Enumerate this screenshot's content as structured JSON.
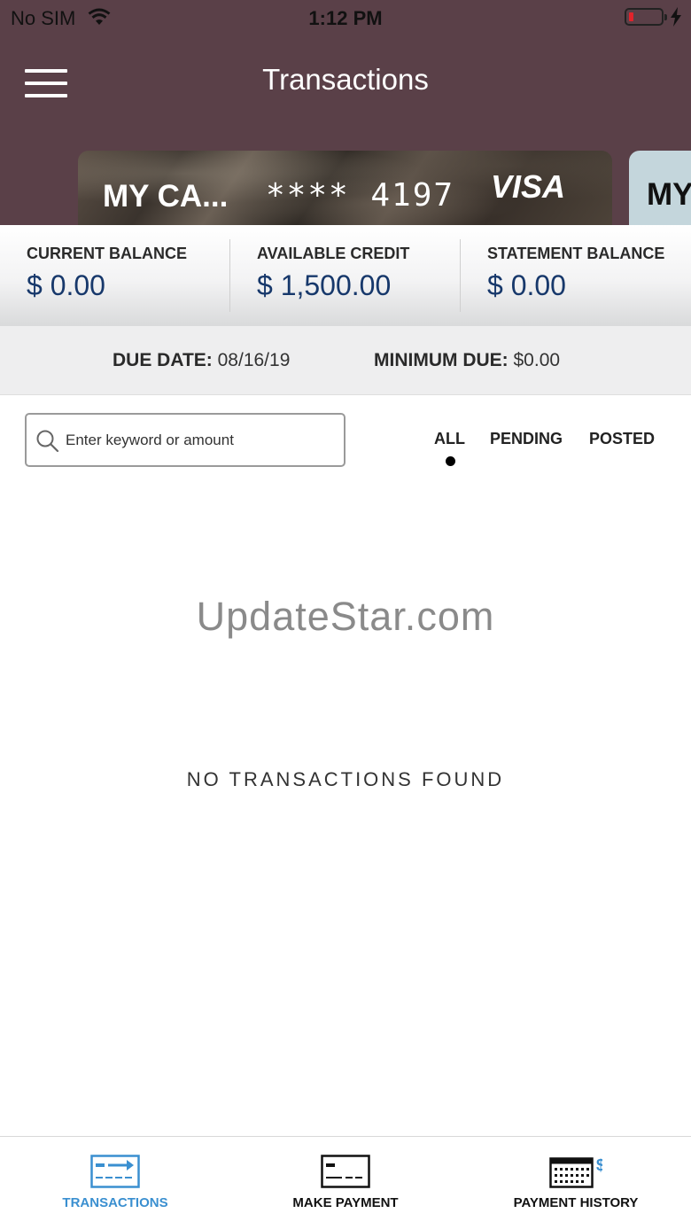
{
  "status_bar": {
    "carrier": "No SIM",
    "time": "1:12 PM",
    "battery_level": 0.1
  },
  "header": {
    "title": "Transactions"
  },
  "cards": [
    {
      "name": "MY CA...",
      "number": "**** 4197",
      "brand": "VISA"
    },
    {
      "name": "MY"
    }
  ],
  "balances": [
    {
      "label": "CURRENT BALANCE",
      "value": "$ 0.00"
    },
    {
      "label": "AVAILABLE CREDIT",
      "value": "$ 1,500.00"
    },
    {
      "label": "STATEMENT BALANCE",
      "value": "$ 0.00"
    }
  ],
  "due": {
    "due_date_label": "DUE DATE:",
    "due_date_value": "08/16/19",
    "min_due_label": "MINIMUM DUE:",
    "min_due_value": "$0.00"
  },
  "search": {
    "placeholder": "Enter keyword or amount",
    "value": ""
  },
  "filters": {
    "items": [
      "ALL",
      "PENDING",
      "POSTED"
    ],
    "selected": "ALL"
  },
  "watermark": "UpdateStar.com",
  "empty_message": "NO TRANSACTIONS FOUND",
  "tabs": [
    {
      "label": "TRANSACTIONS",
      "icon": "transfer-icon",
      "active": true
    },
    {
      "label": "MAKE PAYMENT",
      "icon": "card-icon",
      "active": false
    },
    {
      "label": "PAYMENT HISTORY",
      "icon": "calendar-dollar-icon",
      "active": false
    }
  ],
  "colors": {
    "header": "#5a4048",
    "accent": "#3a8fd0",
    "balance_value": "#17386b"
  }
}
